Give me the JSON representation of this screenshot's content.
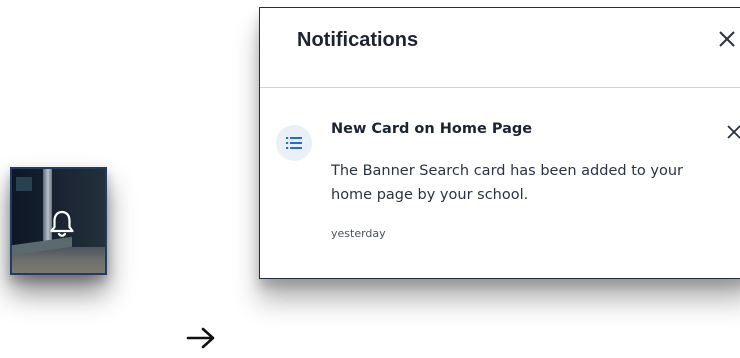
{
  "bell_thumbnail": {
    "icon": "bell-icon"
  },
  "arrow": {
    "icon": "right-arrow-icon"
  },
  "notifications_panel": {
    "title": "Notifications",
    "close_icon": "close-icon",
    "items": [
      {
        "icon": "list-icon",
        "title": "New Card on Home Page",
        "body": "The Banner Search card has been added to your home page by your school.",
        "time": "yesterday",
        "dismiss_icon": "close-icon"
      }
    ]
  },
  "colors": {
    "panel_border": "#1f2f47",
    "icon_accent": "#1f6fd1",
    "icon_bg": "#e9f0f8",
    "text_dark": "#1b2430"
  }
}
